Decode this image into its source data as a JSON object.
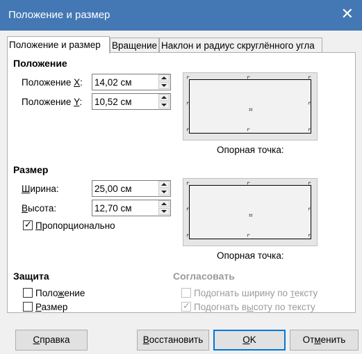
{
  "window": {
    "title": "Положение и размер",
    "close_glyph": "✕"
  },
  "tabs": [
    {
      "label": "Положение и размер",
      "active": true
    },
    {
      "label": "Вращение",
      "active": false
    },
    {
      "label": "Наклон и радиус скруглённого угла",
      "active": false
    }
  ],
  "position": {
    "heading": "Положение",
    "x_label": "Положение X:",
    "x_value": "14,02 см",
    "y_label": "Положение Y:",
    "y_value": "10,52 см",
    "anchor_label": "Опорная точка:"
  },
  "size": {
    "heading": "Размер",
    "width_label": "Ширина:",
    "width_value": "25,00 см",
    "height_label": "Высота:",
    "height_value": "12,70 см",
    "keep_ratio_label": "Пропорционально",
    "keep_ratio_checked": true,
    "anchor_label": "Опорная точка:"
  },
  "protect": {
    "heading": "Защита",
    "position_label": "Положение",
    "position_checked": false,
    "size_label": "Размер",
    "size_checked": false
  },
  "adapt": {
    "heading": "Согласовать",
    "fit_width_label": "Подогнать ширину по тексту",
    "fit_width_checked": false,
    "fit_height_label": "Подогнать высоту по тексту",
    "fit_height_checked": true
  },
  "buttons": {
    "help": "Справка",
    "reset": "Восстановить",
    "ok": "OK",
    "cancel": "Отменить"
  },
  "icons": {
    "corner": "⌜",
    "center": "⌗",
    "check": "✓"
  },
  "colors": {
    "titlebar": "#4478b4",
    "default_button_border": "#0078d7"
  }
}
